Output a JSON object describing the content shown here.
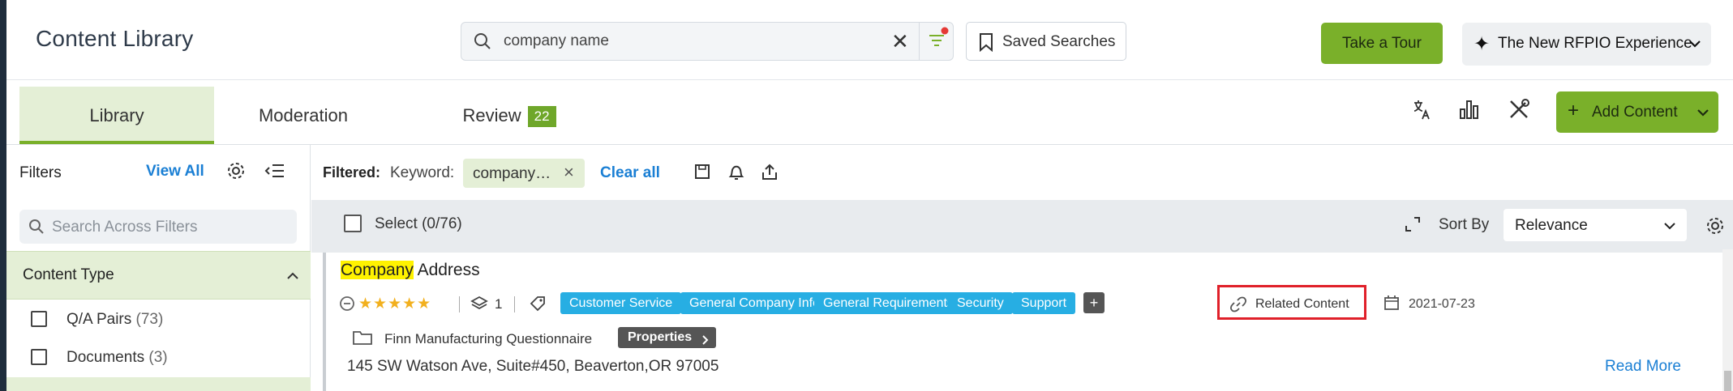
{
  "header": {
    "title": "Content Library",
    "search": {
      "value": "company name"
    },
    "saved_searches": "Saved Searches",
    "take_tour": "Take a Tour",
    "new_experience": "The New RFPIO Experience"
  },
  "tabs": [
    {
      "label": "Library",
      "active": true
    },
    {
      "label": "Moderation"
    },
    {
      "label": "Review",
      "badge": "22"
    }
  ],
  "toolbar": {
    "add_content": "Add Content"
  },
  "filters": {
    "title": "Filters",
    "view_all": "View All",
    "search_placeholder": "Search Across Filters",
    "content_type": "Content Type",
    "items": [
      {
        "label": "Q/A Pairs",
        "count": "(73)"
      },
      {
        "label": "Documents",
        "count": "(3)"
      }
    ]
  },
  "filterbar": {
    "filtered": "Filtered:",
    "keyword": "Keyword:",
    "chip": "company…",
    "clear_all": "Clear all"
  },
  "selectbar": {
    "select": "Select (0/76)",
    "sort_by": "Sort By",
    "sort_value": "Relevance"
  },
  "card": {
    "title_highlight": "Company",
    "title_rest": " Address",
    "stars": "★★★★★",
    "versions": "1",
    "tags": [
      "Customer Service",
      "General Company Info",
      "General Requirements",
      "Security",
      "Support"
    ],
    "more_tags": "+",
    "related": "Related Content",
    "date": "2021-07-23",
    "questionnaire": "Finn Manufacturing Questionnaire",
    "properties": "Properties",
    "address": "145 SW Watson Ave, Suite#450, Beaverton,OR 97005",
    "read_more": "Read More"
  },
  "colors": {
    "accent_green": "#7ab02a",
    "tag_blue": "#27aee3",
    "link_blue": "#1a7fd4",
    "highlight": "#fff200",
    "callout_red": "#e0202a"
  }
}
